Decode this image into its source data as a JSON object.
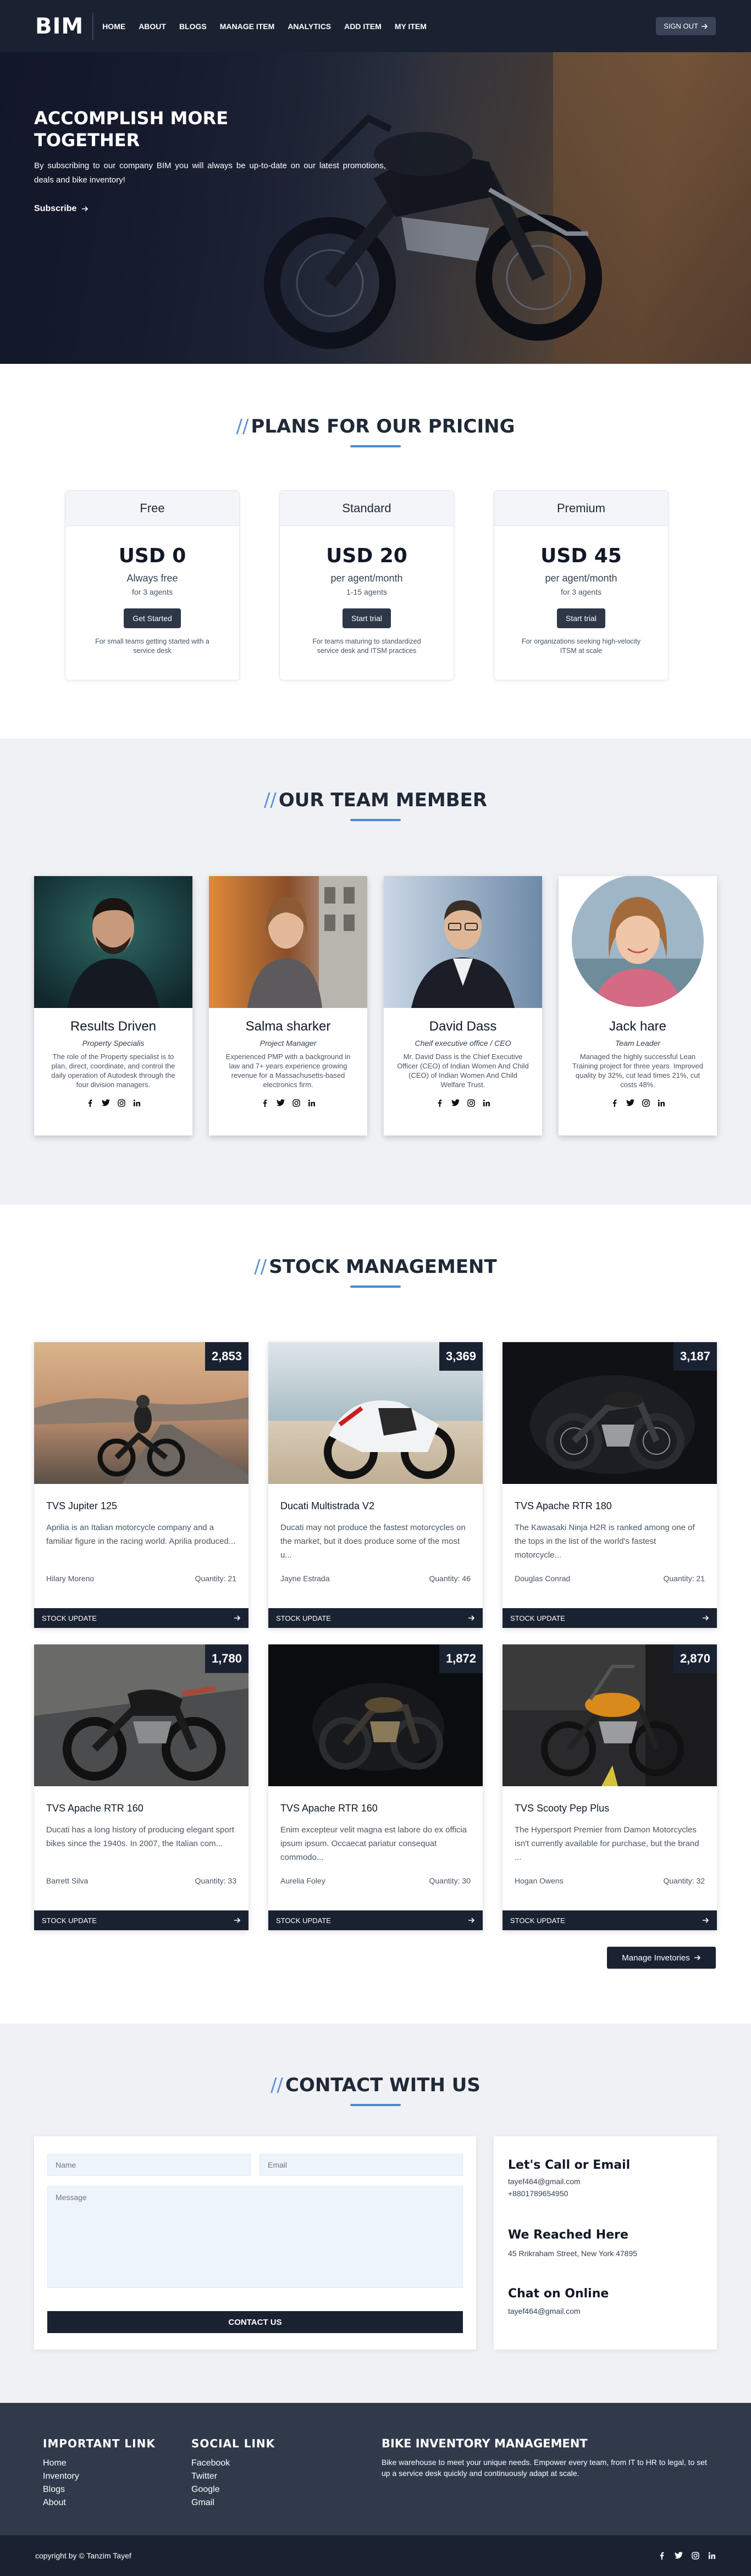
{
  "nav": {
    "brand": "BIM",
    "items": [
      "HOME",
      "ABOUT",
      "BLOGS",
      "MANAGE ITEM",
      "ANALYTICS",
      "ADD ITEM",
      "MY ITEM"
    ],
    "signout": "SIGN OUT"
  },
  "hero": {
    "title": "ACCOMPLISH MORE TOGETHER",
    "subtitle": "By subscribing to our company BIM you will always be up-to-date on our latest promotions, deals and bike inventory!",
    "cta": "Subscribe"
  },
  "pricing": {
    "title": "PLANS FOR OUR PRICING",
    "plans": [
      {
        "name": "Free",
        "price": "USD 0",
        "per": "Always free",
        "agents": "for 3 agents",
        "button": "Get Started",
        "note": "For small teams getting started with a service desk"
      },
      {
        "name": "Standard",
        "price": "USD 20",
        "per": "per agent/month",
        "agents": "1-15 agents",
        "button": "Start trial",
        "note": "For teams maturing to standardized service desk and ITSM practices"
      },
      {
        "name": "Premium",
        "price": "USD 45",
        "per": "per agent/month",
        "agents": "for 3 agents",
        "button": "Start trial",
        "note": "For organizations seeking high-velocity ITSM at scale"
      }
    ]
  },
  "team": {
    "title": "OUR TEAM MEMBER",
    "members": [
      {
        "name": "Results Driven",
        "role": "Property Specialis",
        "bio": "The role of the Property specialist is to plan, direct, coordinate, and control the daily operation of Autodesk through the four division managers."
      },
      {
        "name": "Salma sharker",
        "role": "Project Manager",
        "bio": "Experienced PMP with a background in law and 7+ years experience growing revenue for a Massachusetts-based electronics firm."
      },
      {
        "name": "David Dass",
        "role": "Cheif executive office / CEO",
        "bio": "Mr. David Dass is the Chief Executive Officer (CEO) of Indian Women And Child (CEO) of Indian Women And Child Welfare Trust."
      },
      {
        "name": "Jack hare",
        "role": "Team Leader",
        "bio": "Managed the highly successful Lean Training project for three years. Improved quality by 32%, cut lead times 21%, cut costs 48%."
      }
    ]
  },
  "stock": {
    "title": "STOCK MANAGEMENT",
    "quantity_label": "Quantity:",
    "update_label": "STOCK UPDATE",
    "manage_label": "Manage Invetories",
    "items": [
      {
        "badge": "2,853",
        "name": "TVS Jupiter 125",
        "desc": "Aprilia is an Italian motorcycle company and a familiar figure in the racing world. Aprilia produced...",
        "supplier": "Hilary Moreno",
        "qty": "21"
      },
      {
        "badge": "3,369",
        "name": "Ducati Multistrada V2",
        "desc": "Ducati may not produce the fastest motorcycles on the market, but it does produce some of the most u...",
        "supplier": "Jayne Estrada",
        "qty": "46"
      },
      {
        "badge": "3,187",
        "name": "TVS Apache RTR 180",
        "desc": "The Kawasaki Ninja H2R is ranked among one of the tops in the list of the world's fastest motorcycle...",
        "supplier": "Douglas Conrad",
        "qty": "21"
      },
      {
        "badge": "1,780",
        "name": "TVS Apache RTR 160",
        "desc": "Ducati has a long history of producing elegant sport bikes since the 1940s. In 2007, the Italian com...",
        "supplier": "Barrett Silva",
        "qty": "33"
      },
      {
        "badge": "1,872",
        "name": "TVS Apache RTR 160",
        "desc": "Enim excepteur velit magna est labore do ex officia ipsum ipsum. Occaecat pariatur consequat commodo...",
        "supplier": "Aurelia Foley",
        "qty": "30"
      },
      {
        "badge": "2,870",
        "name": "TVS Scooty Pep Plus",
        "desc": "The Hypersport Premier from Damon Motorcycles isn't currently available for purchase, but the brand ...",
        "supplier": "Hogan Owens",
        "qty": "32"
      }
    ]
  },
  "contact": {
    "title": "CONTACT WITH US",
    "name_placeholder": "Name",
    "email_placeholder": "Email",
    "message_placeholder": "Message",
    "submit": "CONTACT US",
    "call_title": "Let's Call or Email",
    "email": "tayef464@gmail.com",
    "phone": "+8801789654950",
    "reach_title": "We Reached Here",
    "address": "45 Rrikraham Street, New York 47895",
    "chat_title": "Chat on Online",
    "chat": "tayef464@gmail.com"
  },
  "footer": {
    "important_title": "IMPORTANT LINK",
    "important_links": [
      "Home",
      "Inventory",
      "Blogs",
      "About"
    ],
    "social_title": "SOCIAL LINK",
    "social_links": [
      "Facebook",
      "Twitter",
      "Google",
      "Gmail"
    ],
    "about_title": "BIKE INVENTORY MANAGEMENT",
    "about_text": "Bike warehouse to meet your unique needs. Empower every team, from IT to HR to legal, to set up a service desk quickly and continuously adapt at scale.",
    "copyright": "copyright by © Tanzim Tayef"
  },
  "icons": [
    "arrow-right-icon",
    "facebook-icon",
    "twitter-icon",
    "instagram-icon",
    "linkedin-icon"
  ],
  "colors": {
    "navy": "#1a2232",
    "accent": "#4f86d3",
    "footer": "#303a4b",
    "light": "#f0f1f5"
  }
}
